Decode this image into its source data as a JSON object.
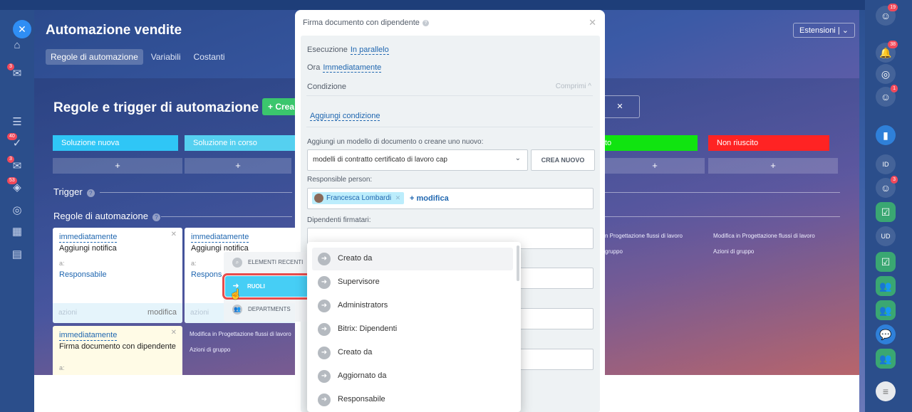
{
  "colors": {
    "accent": "#2067b0",
    "roles_highlight": "#46cef5",
    "focus_outline": "#e84c4c",
    "stage_failed": "#ff2323",
    "stage_won": "#10e410",
    "stage_new": "#2fc6f6"
  },
  "panel": {
    "title": "Automazione vendite",
    "tabs": [
      "Regole di automazione",
      "Variabili",
      "Costanti"
    ],
    "extensions_label": "Estensioni",
    "heading": "Regole e trigger di automazione",
    "create_label": "+ Crea",
    "stages": [
      "Soluzione nuova",
      "Soluzione in corso",
      "to",
      "Non riuscito"
    ],
    "stage_add": "+",
    "trigger_label": "Trigger",
    "rules_label": "Regole di automazione",
    "cards": [
      {
        "when": "immediatamente",
        "action": "Aggiungi notifica",
        "a": "a:",
        "resp": "Responsabile",
        "foot_left": "azioni",
        "foot_right": "modifica"
      },
      {
        "when": "immediatamente",
        "action": "Aggiungi notifica",
        "a": "a:",
        "resp": "Respons",
        "foot_left": "azioni",
        "foot_right": ""
      },
      {
        "when": "immediatamente",
        "action": "Firma documento con dipendente",
        "a": "a:"
      }
    ],
    "side_links": [
      "Modifica in Progettazione flussi di lavoro",
      "Azioni di gruppo",
      "n Progettazione flussi di lavoro",
      "gruppo",
      "Modifica in Progettazione flussi di lavoro",
      "Azioni di gruppo"
    ]
  },
  "dialog": {
    "title": "Firma documento con dipendente",
    "execution_label": "Esecuzione",
    "execution_value": "In parallelo",
    "time_label": "Ora",
    "time_value": "Immediatamente",
    "condition_label": "Condizione",
    "collapse_label": "Comprimi ^",
    "add_condition": "Aggiungi condizione",
    "template_label": "Aggiungi un modello di documento o creane uno nuovo:",
    "template_value": "modelli di contratto certificato di lavoro cap",
    "create_new": "CREA NUOVO",
    "responsible_label": "Responsible person:",
    "responsible_chip": "Francesca Lombardi",
    "responsible_change": "+ modifica",
    "signers_label": "Dipendenti firmatari:"
  },
  "selector": {
    "tabs": [
      "ELEMENTI RECENTI",
      "RUOLI",
      "DEPARTMENTS"
    ],
    "items": [
      "Creato da",
      "Supervisore",
      "Administrators",
      "Bitrix: Dipendenti",
      "Creato da",
      "Aggiornato da",
      "Responsabile"
    ]
  },
  "rails": {
    "left_badges": [
      "3",
      "40",
      "3",
      "53"
    ],
    "right_badges": [
      "19",
      "38",
      "1",
      "3"
    ],
    "right_initials": [
      "ID",
      "UD"
    ]
  }
}
